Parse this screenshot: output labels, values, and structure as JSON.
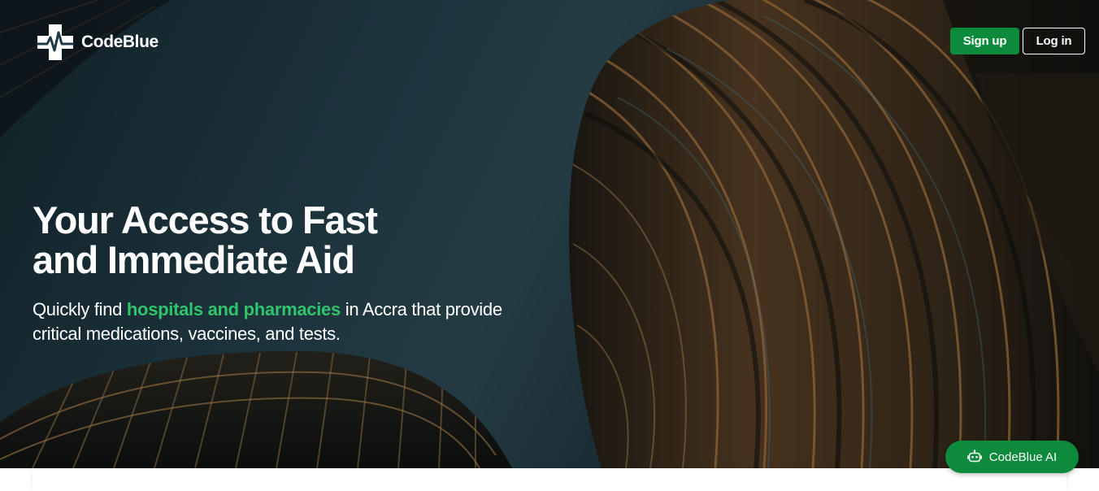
{
  "brand": {
    "name": "CodeBlue",
    "logo_icon": "medical-cross-heartbeat-icon"
  },
  "nav": {
    "signup_label": "Sign up",
    "login_label": "Log in"
  },
  "hero": {
    "headline_line1": "Your Access to Fast",
    "headline_line2": "and Immediate Aid",
    "sub_before": "Quickly find ",
    "sub_highlight": "hospitals and pharmacies",
    "sub_after_line1": " in Accra that provide",
    "sub_line2": "critical medications, vaccines, and tests."
  },
  "assistant": {
    "label": "CodeBlue AI",
    "icon": "robot-icon"
  },
  "colors": {
    "accent_green": "#0d8a3b",
    "highlight_green": "#2fc56c",
    "text": "#ffffff"
  }
}
